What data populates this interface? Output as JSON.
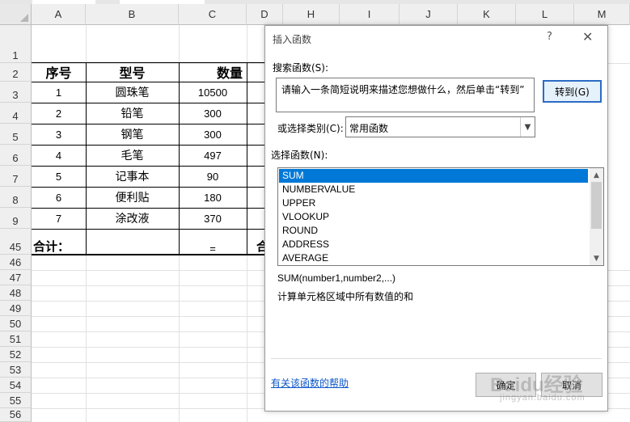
{
  "sheet": {
    "columns": [
      "A",
      "B",
      "C",
      "D",
      "H",
      "I",
      "J",
      "K",
      "L",
      "M"
    ],
    "rows": [
      "1",
      "2",
      "3",
      "4",
      "5",
      "6",
      "7",
      "8",
      "9",
      "45",
      "46",
      "47",
      "48",
      "49",
      "50",
      "51",
      "52",
      "53",
      "54",
      "55",
      "56"
    ],
    "table": {
      "headers": [
        "序号",
        "型号",
        "数量"
      ],
      "rows": [
        [
          "1",
          "圆珠笔",
          "10500"
        ],
        [
          "2",
          "铅笔",
          "300"
        ],
        [
          "3",
          "钢笔",
          "300"
        ],
        [
          "4",
          "毛笔",
          "497"
        ],
        [
          "5",
          "记事本",
          "90"
        ],
        [
          "6",
          "便利贴",
          "180"
        ],
        [
          "7",
          "涂改液",
          "370"
        ]
      ],
      "total_label": "合计：",
      "total_formula": "=",
      "total_partial": "合"
    }
  },
  "dialog": {
    "title": "插入函数",
    "help_glyph": "?",
    "close_glyph": "✕",
    "search_label": "搜索函数(S):",
    "search_value": "请输入一条简短说明来描述您想做什么，然后单击“转到”",
    "goto_button": "转到(G)",
    "category_label": "或选择类别(C):",
    "category_value": "常用函数",
    "select_label": "选择函数(N):",
    "functions": [
      "SUM",
      "NUMBERVALUE",
      "UPPER",
      "VLOOKUP",
      "ROUND",
      "ADDRESS",
      "AVERAGE"
    ],
    "selected_function": "SUM",
    "syntax": "SUM(number1,number2,...)",
    "description": "计算单元格区域中所有数值的和",
    "help_link": "有关该函数的帮助",
    "ok_button": "确定",
    "cancel_button": "取消"
  },
  "watermark": {
    "text": "Baidu经验",
    "sub": "jingyan.baidu.com"
  },
  "colors": {
    "selection": "#0078d7",
    "link": "#0b56c9",
    "default_button_border": "#2b6cc4"
  }
}
